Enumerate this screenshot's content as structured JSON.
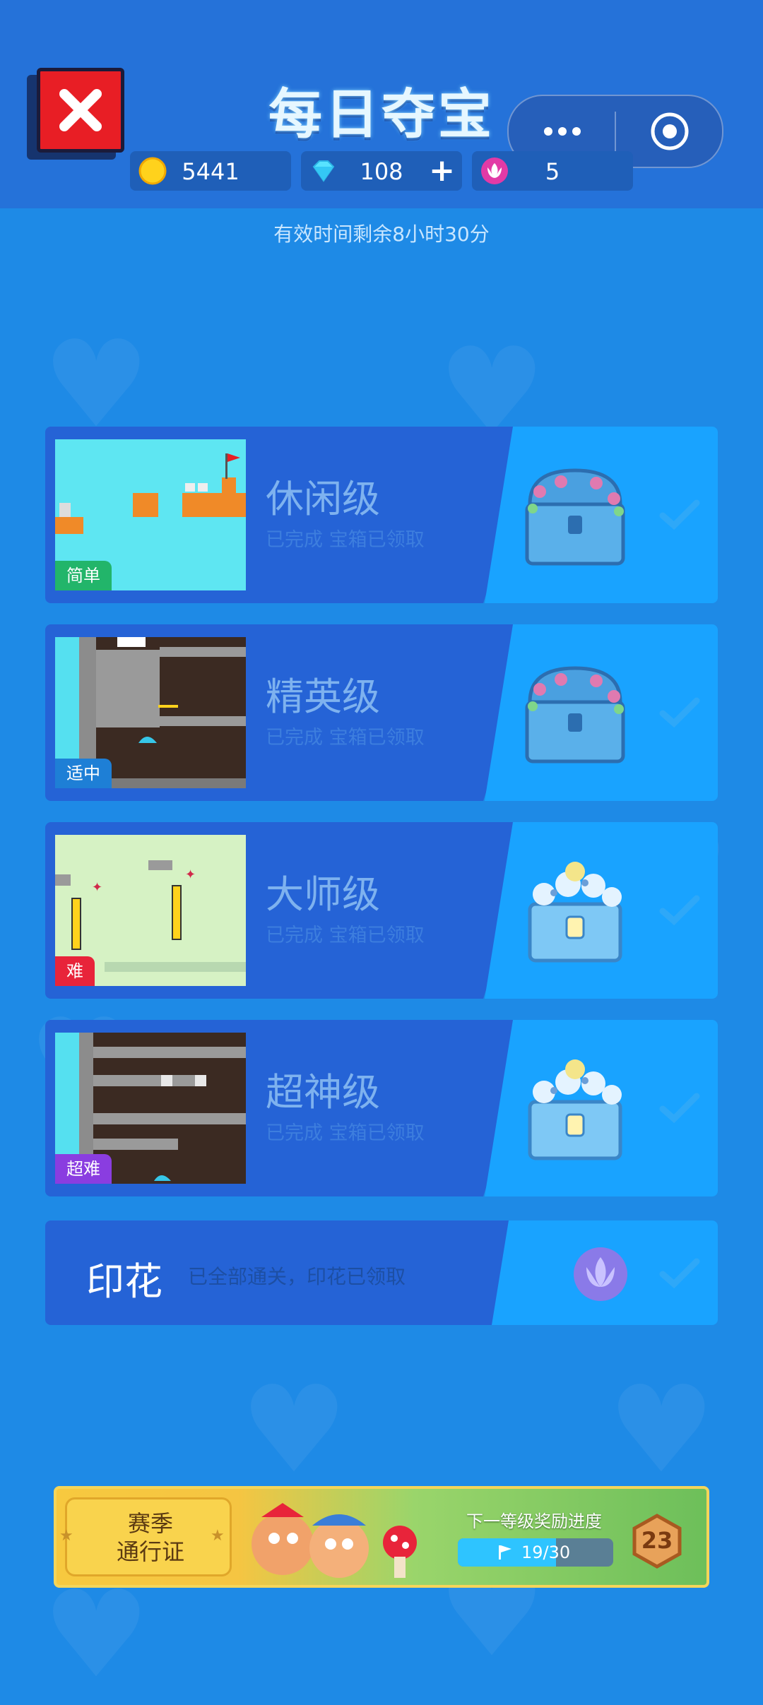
{
  "header": {
    "title": "每日夺宝",
    "currencies": [
      {
        "icon": "gold-coin-icon",
        "value": "5441",
        "has_plus": false
      },
      {
        "icon": "diamond-icon",
        "value": "108",
        "has_plus": true
      },
      {
        "icon": "lotus-stamp-icon",
        "value": "5",
        "has_plus": false
      }
    ],
    "plus_symbol": "+"
  },
  "timer_text": "有效时间剩余8小时30分",
  "levels": [
    {
      "name": "休闲级",
      "status": "已完成 宝箱已领取",
      "tag": "简单",
      "tag_color": "#22b56a",
      "chest": "wooden-chest-icon"
    },
    {
      "name": "精英级",
      "status": "已完成 宝箱已领取",
      "tag": "适中",
      "tag_color": "#1e7fd6",
      "chest": "wooden-chest-icon"
    },
    {
      "name": "大师级",
      "status": "已完成 宝箱已领取",
      "tag": "难",
      "tag_color": "#e8243a",
      "chest": "flower-chest-icon"
    },
    {
      "name": "超神级",
      "status": "已完成 宝箱已领取",
      "tag": "超难",
      "tag_color": "#8a3de0",
      "chest": "flower-chest-icon"
    }
  ],
  "stamp": {
    "title": "印花",
    "status": "已全部通关，印花已领取"
  },
  "season_pass": {
    "label_line1": "赛季",
    "label_line2": "通行证",
    "progress_label": "下一等级奖励进度",
    "progress_text": "19/30",
    "progress_fraction": 0.633,
    "level": "23"
  },
  "colors": {
    "background": "#1e8ae6",
    "card_left": "#2563d6",
    "card_right": "#19a3ff",
    "close_red": "#e81e25"
  }
}
